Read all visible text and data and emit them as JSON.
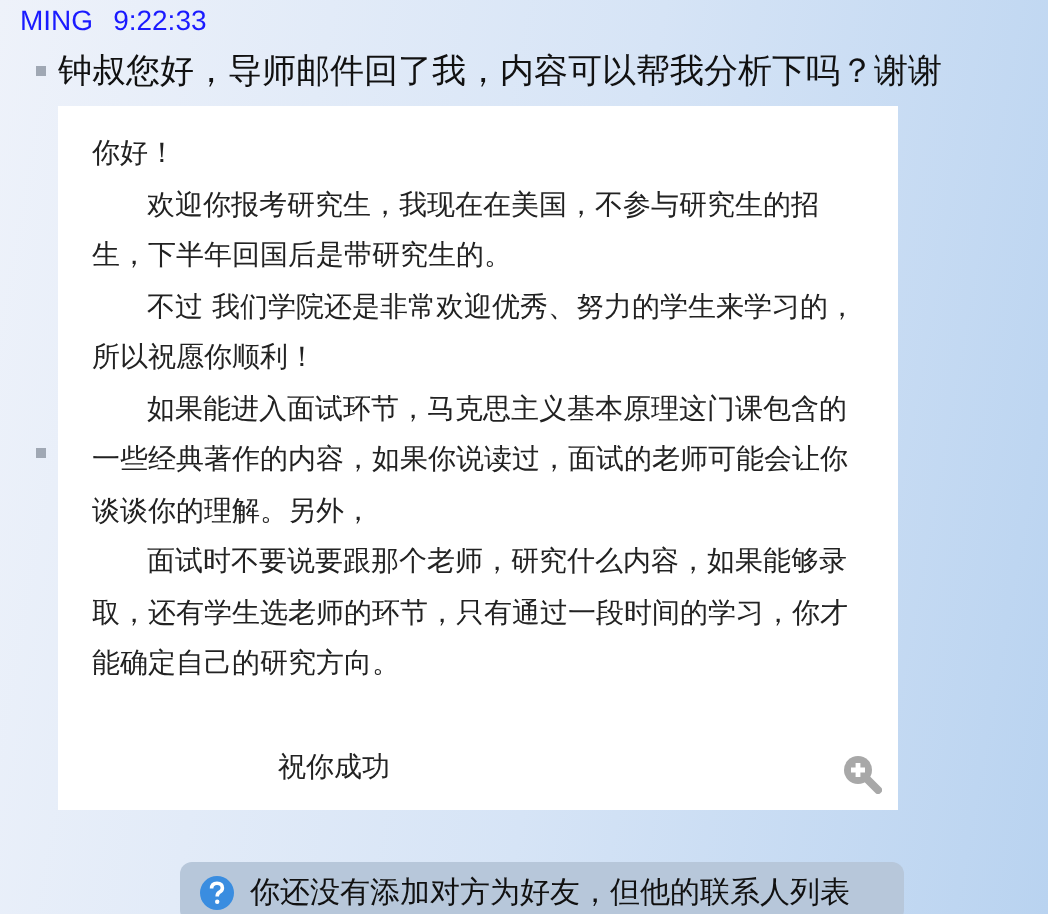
{
  "message": {
    "sender": "MING",
    "time": "9:22:33",
    "items": [
      {
        "kind": "text",
        "text": "钟叔您好，导师邮件回了我，内容可以帮我分析下吗？谢谢"
      },
      {
        "kind": "document",
        "paragraphs": [
          {
            "kind": "greeting",
            "text": "你好！"
          },
          {
            "kind": "body",
            "text": "欢迎你报考研究生，我现在在美国，不参与研究生的招生，下半年回国后是带研究生的。"
          },
          {
            "kind": "body",
            "text": "不过 我们学院还是非常欢迎优秀、努力的学生来学习的，所以祝愿你顺利！"
          },
          {
            "kind": "body",
            "text": "如果能进入面试环节，马克思主义基本原理这门课包含的一些经典著作的内容，如果你说读过，面试的老师可能会让你谈谈你的理解。另外，"
          },
          {
            "kind": "body",
            "text": "面试时不要说要跟那个老师，研究什么内容，如果能够录取，还有学生选老师的环节，只有通过一段时间的学习，你才能确定自己的研究方向。"
          },
          {
            "kind": "closing",
            "text": "祝你成功"
          }
        ]
      }
    ]
  },
  "notice": {
    "text": "你还没有添加对方为好友，但他的联系人列表"
  }
}
